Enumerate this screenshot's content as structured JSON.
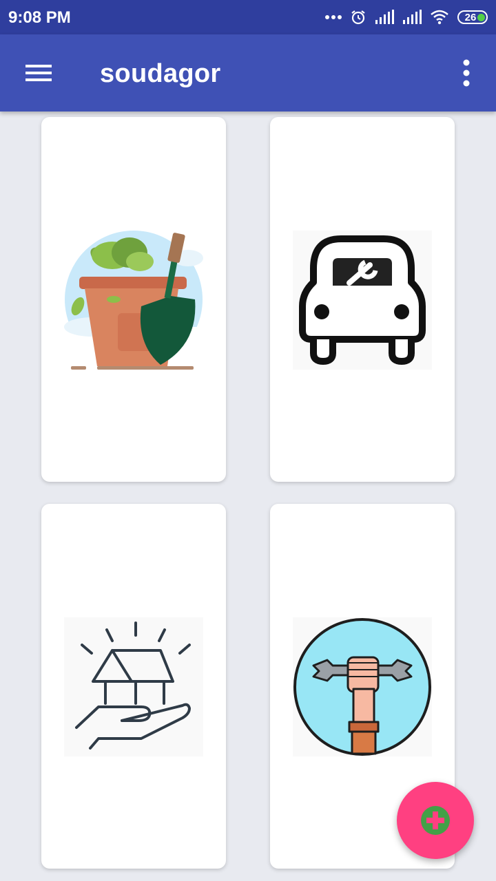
{
  "status_bar": {
    "time": "9:08 PM",
    "battery_level": "26",
    "icons": [
      "more-dots-icon",
      "alarm-icon",
      "signal-icon",
      "signal-icon",
      "wifi-icon",
      "battery-icon"
    ]
  },
  "app_bar": {
    "title": "soudagor",
    "menu_icon": "hamburger-menu-icon",
    "overflow_icon": "more-vert-icon"
  },
  "categories": [
    {
      "icon": "garden-pot-shovel-icon"
    },
    {
      "icon": "car-repair-icon"
    },
    {
      "icon": "home-in-hand-icon"
    },
    {
      "icon": "hand-wrench-icon"
    }
  ],
  "fab": {
    "icon": "add-circle-icon",
    "color": "#ff4081",
    "inner_color": "#43a047"
  },
  "colors": {
    "status_bar": "#2f3e9e",
    "app_bar": "#3f51b5",
    "background": "#e8eaf0"
  }
}
